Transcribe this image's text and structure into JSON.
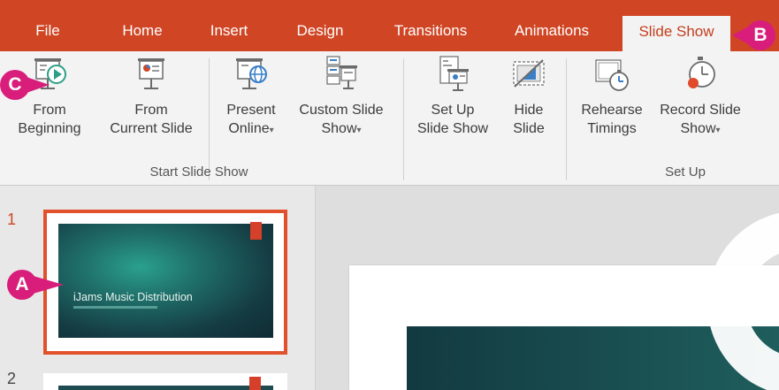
{
  "tabs": [
    {
      "label": "File"
    },
    {
      "label": "Home"
    },
    {
      "label": "Insert"
    },
    {
      "label": "Design"
    },
    {
      "label": "Transitions"
    },
    {
      "label": "Animations"
    },
    {
      "label": "Slide Show"
    }
  ],
  "active_tab": "Slide Show",
  "ribbon": {
    "start_group": {
      "label": "Start Slide Show",
      "from_beginning": {
        "line1": "From",
        "line2": "Beginning"
      },
      "from_current": {
        "line1": "From",
        "line2": "Current Slide"
      },
      "present_online": {
        "line1": "Present",
        "line2": "Online"
      },
      "custom_show": {
        "line1": "Custom Slide",
        "line2": "Show"
      }
    },
    "setup_group": {
      "label": "Set Up",
      "setup_show": {
        "line1": "Set Up",
        "line2": "Slide Show"
      },
      "hide_slide": {
        "line1": "Hide",
        "line2": "Slide"
      },
      "rehearse": {
        "line1": "Rehearse",
        "line2": "Timings"
      },
      "record": {
        "line1": "Record Slide",
        "line2": "Show"
      }
    },
    "caret": "▾"
  },
  "thumbnails": [
    {
      "number": "1",
      "title": "iJams Music Distribution"
    },
    {
      "number": "2"
    }
  ],
  "callouts": {
    "a": "A",
    "b": "B",
    "c": "C"
  },
  "colors": {
    "accent": "#d04625",
    "callout": "#d81e7a",
    "slide_teal": "#1f6e69"
  }
}
